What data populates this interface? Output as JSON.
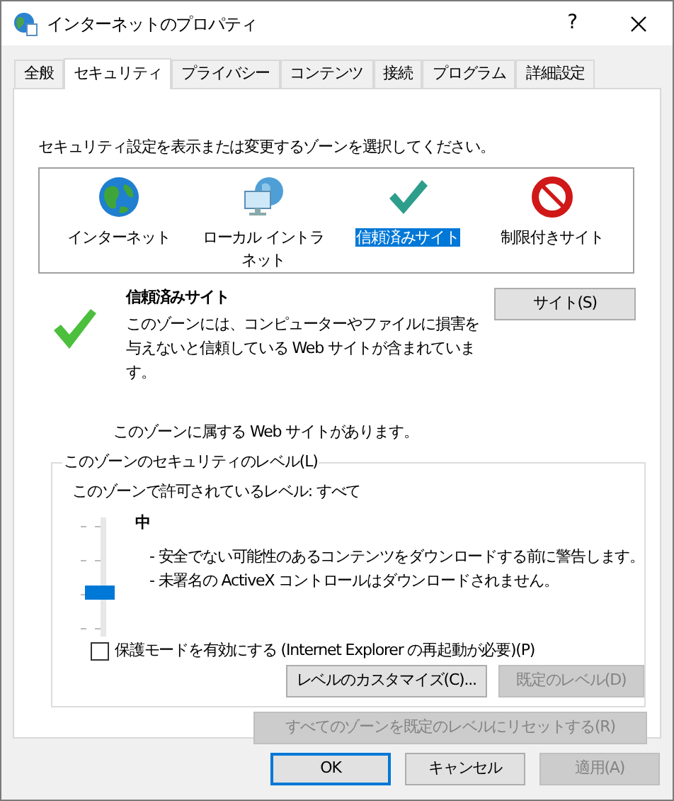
{
  "window": {
    "title": "インターネットのプロパティ",
    "help": "?"
  },
  "tabs": [
    {
      "label": "全般",
      "selected": false
    },
    {
      "label": "セキュリティ",
      "selected": true
    },
    {
      "label": "プライバシー",
      "selected": false
    },
    {
      "label": "コンテンツ",
      "selected": false
    },
    {
      "label": "接続",
      "selected": false
    },
    {
      "label": "プログラム",
      "selected": false
    },
    {
      "label": "詳細設定",
      "selected": false
    }
  ],
  "zones": {
    "instruction": "セキュリティ設定を表示または変更するゾーンを選択してください。",
    "items": [
      {
        "label": "インターネット",
        "kind": "internet",
        "selected": false
      },
      {
        "label": "ローカル イントラネット",
        "kind": "intranet",
        "selected": false
      },
      {
        "label": "信頼済みサイト",
        "kind": "trusted",
        "selected": true
      },
      {
        "label": "制限付きサイト",
        "kind": "restricted",
        "selected": false
      }
    ]
  },
  "zone_info": {
    "title": "信頼済みサイト",
    "description": "このゾーンには、コンピューターやファイルに損害を与えないと信頼している Web サイトが含まれています。",
    "sites_button": "サイト(S)",
    "note": "このゾーンに属する Web サイトがあります。"
  },
  "level_group": {
    "legend": "このゾーンのセキュリティのレベル(L)",
    "allowed": "このゾーンで許可されているレベル: すべて",
    "level": 0.33,
    "level_name": "中",
    "bullets": [
      "- 安全でない可能性のあるコンテンツをダウンロードする前に警告します。",
      "- 未署名の ActiveX コントロールはダウンロードされません。"
    ],
    "protected_mode": {
      "label": "保護モードを有効にする (Internet Explorer の再起動が必要)(P)",
      "checked": false
    },
    "custom_button": {
      "label": "レベルのカスタマイズ(C)...",
      "disabled": false
    },
    "default_button": {
      "label": "既定のレベル(D)",
      "disabled": true
    }
  },
  "reset_button": {
    "label": "すべてのゾーンを既定のレベルにリセットする(R)",
    "disabled": true
  },
  "footer_buttons": [
    {
      "label": "OK",
      "disabled": false,
      "default": true
    },
    {
      "label": "キャンセル",
      "disabled": false,
      "default": false
    },
    {
      "label": "適用(A)",
      "disabled": true,
      "default": false
    }
  ]
}
